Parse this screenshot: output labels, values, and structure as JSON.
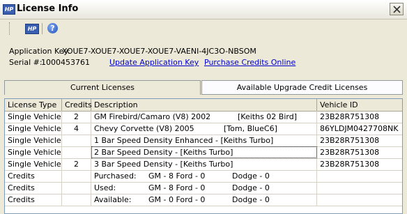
{
  "window": {
    "title": "License Info",
    "logo_text": "HP"
  },
  "toolbar": {
    "hp_text": "HP",
    "help_glyph": "?"
  },
  "info": {
    "app_key_label": "Application Key:",
    "app_key_value": "XOUE7-XOUE7-XOUE7-XOUE7-VAENI-4JC3O-NBSOM",
    "serial_label": "Serial #:",
    "serial_value": "1000453761",
    "update_link": "Update Application Key",
    "purchase_link": "Purchase Credits Online"
  },
  "tabs": [
    {
      "label": "Current Licenses",
      "selected": true
    },
    {
      "label": "Available Upgrade Credit Licenses",
      "selected": false
    }
  ],
  "table": {
    "columns": [
      "License Type",
      "Credits",
      "Description",
      "Vehicle ID"
    ],
    "rows": [
      {
        "type": "Single Vehicle",
        "credits": "2",
        "desc": [
          "GM  Firebird/Camaro  (V8)  2002",
          "[Keiths 02 Bird]"
        ],
        "vehicle": "23B28R751308"
      },
      {
        "type": "Single Vehicle",
        "credits": "4",
        "desc": [
          "Chevy  Corvette  (V8)  2005",
          "[Tom, BlueC6]"
        ],
        "vehicle": "86YLDJM0427708NK"
      },
      {
        "type": "Single Vehicle",
        "credits": "",
        "desc": [
          "1 Bar Speed Density Enhanced - [Keiths Turbo]"
        ],
        "vehicle": "23B28R751308"
      },
      {
        "type": "Single Vehicle",
        "credits": "",
        "desc": [
          "2 Bar Speed Density - [Keiths Turbo]"
        ],
        "vehicle": "23B28R751308"
      },
      {
        "type": "Single Vehicle",
        "credits": "2",
        "desc": [
          "3 Bar Speed Density - [Keiths Turbo]"
        ],
        "vehicle": "23B28R751308"
      },
      {
        "type": "Credits",
        "credits": "",
        "desc": [
          "Purchased:",
          "GM - 8  Ford - 0",
          "Dodge - 0"
        ],
        "vehicle": ""
      },
      {
        "type": "Credits",
        "credits": "",
        "desc": [
          "Used:",
          "GM - 8  Ford - 0",
          "Dodge - 0"
        ],
        "vehicle": ""
      },
      {
        "type": "Credits",
        "credits": "",
        "desc": [
          "Available:",
          "GM - 0  Ford - 0",
          "Dodge - 0"
        ],
        "vehicle": ""
      }
    ]
  }
}
